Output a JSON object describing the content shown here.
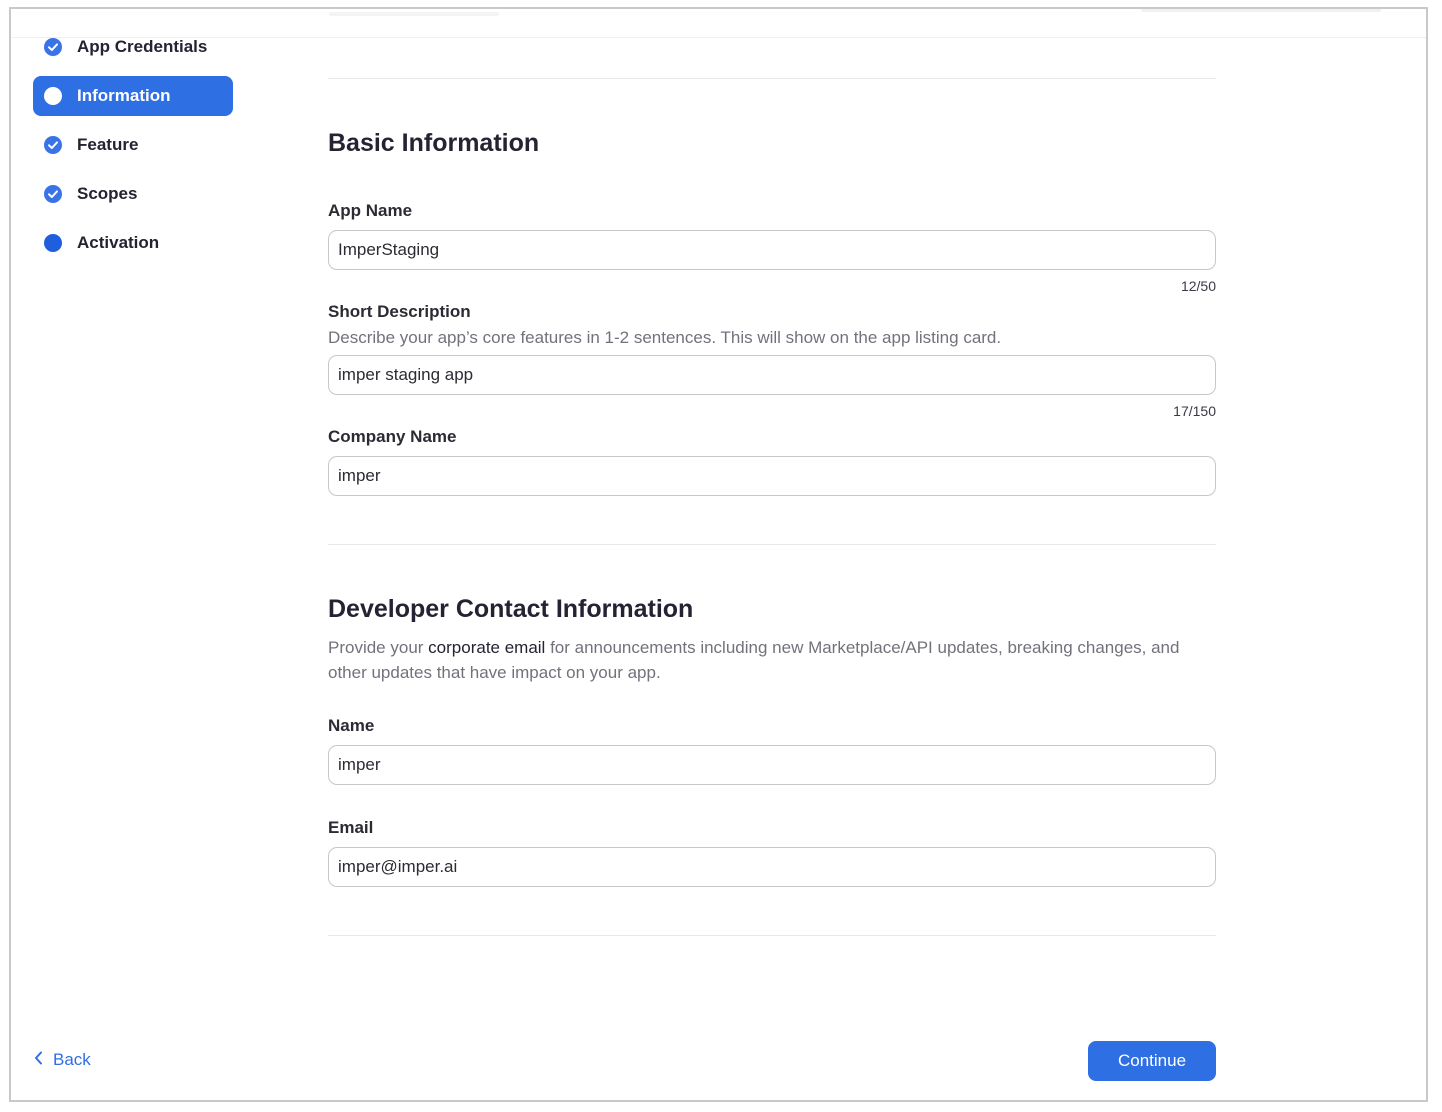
{
  "sidebar": {
    "items": [
      {
        "label": "App Credentials",
        "state": "done"
      },
      {
        "label": "Information",
        "state": "active"
      },
      {
        "label": "Feature",
        "state": "done"
      },
      {
        "label": "Scopes",
        "state": "done"
      },
      {
        "label": "Activation",
        "state": "pending"
      }
    ]
  },
  "basic": {
    "title": "Basic Information",
    "app_name_label": "App Name",
    "app_name_value": "ImperStaging",
    "app_name_counter": "12/50",
    "short_desc_label": "Short Description",
    "short_desc_hint": "Describe your app’s core features in 1-2 sentences. This will show on the app listing card.",
    "short_desc_value": "imper staging app",
    "short_desc_counter": "17/150",
    "company_label": "Company Name",
    "company_value": "imper"
  },
  "developer": {
    "title": "Developer Contact Information",
    "hint_prefix": "Provide your ",
    "hint_strong": "corporate email",
    "hint_suffix": " for announcements including new Marketplace/API updates, breaking changes, and other updates that have impact on your app.",
    "name_label": "Name",
    "name_value": "imper",
    "email_label": "Email",
    "email_value": "imper@imper.ai"
  },
  "footer": {
    "back_label": "Back",
    "continue_label": "Continue"
  },
  "colors": {
    "accent": "#2f6fe4",
    "check": "#3a73e8"
  }
}
